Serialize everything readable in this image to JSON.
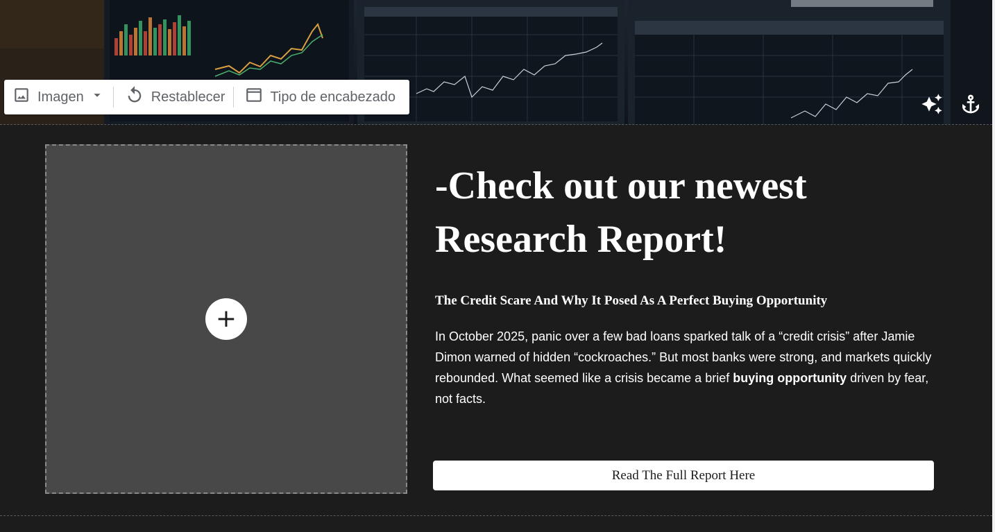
{
  "toolbar": {
    "image_label": "Imagen",
    "reset_label": "Restablecer",
    "header_type_label": "Tipo de encabezado",
    "icons": [
      "image-icon",
      "dropdown-arrow-icon",
      "reset-icon",
      "header-type-icon"
    ]
  },
  "corner_icons": [
    "sparkle-icon",
    "anchor-icon"
  ],
  "content": {
    "heading": "-Check out our newest Research Report!",
    "subheading": "The Credit Scare And Why It Posed As A Perfect Buying Opportunity",
    "body_before": "In October 2025, panic over a few bad loans sparked talk of a “credit crisis” after Jamie Dimon warned of hidden “cockroaches.” But most banks were strong, and markets quickly rebounded. What seemed like a crisis became a brief ",
    "body_bold": "buying opportunity",
    "body_after": " driven by fear, not facts.",
    "cta_label": "Read The Full Report Here",
    "add_icon": "plus-icon"
  },
  "colors": {
    "page_bg": "#1c1c1c",
    "placeholder_bg": "#484848",
    "toolbar_bg": "#ffffff",
    "toolbar_text": "#5f6368",
    "text": "#ffffff"
  }
}
